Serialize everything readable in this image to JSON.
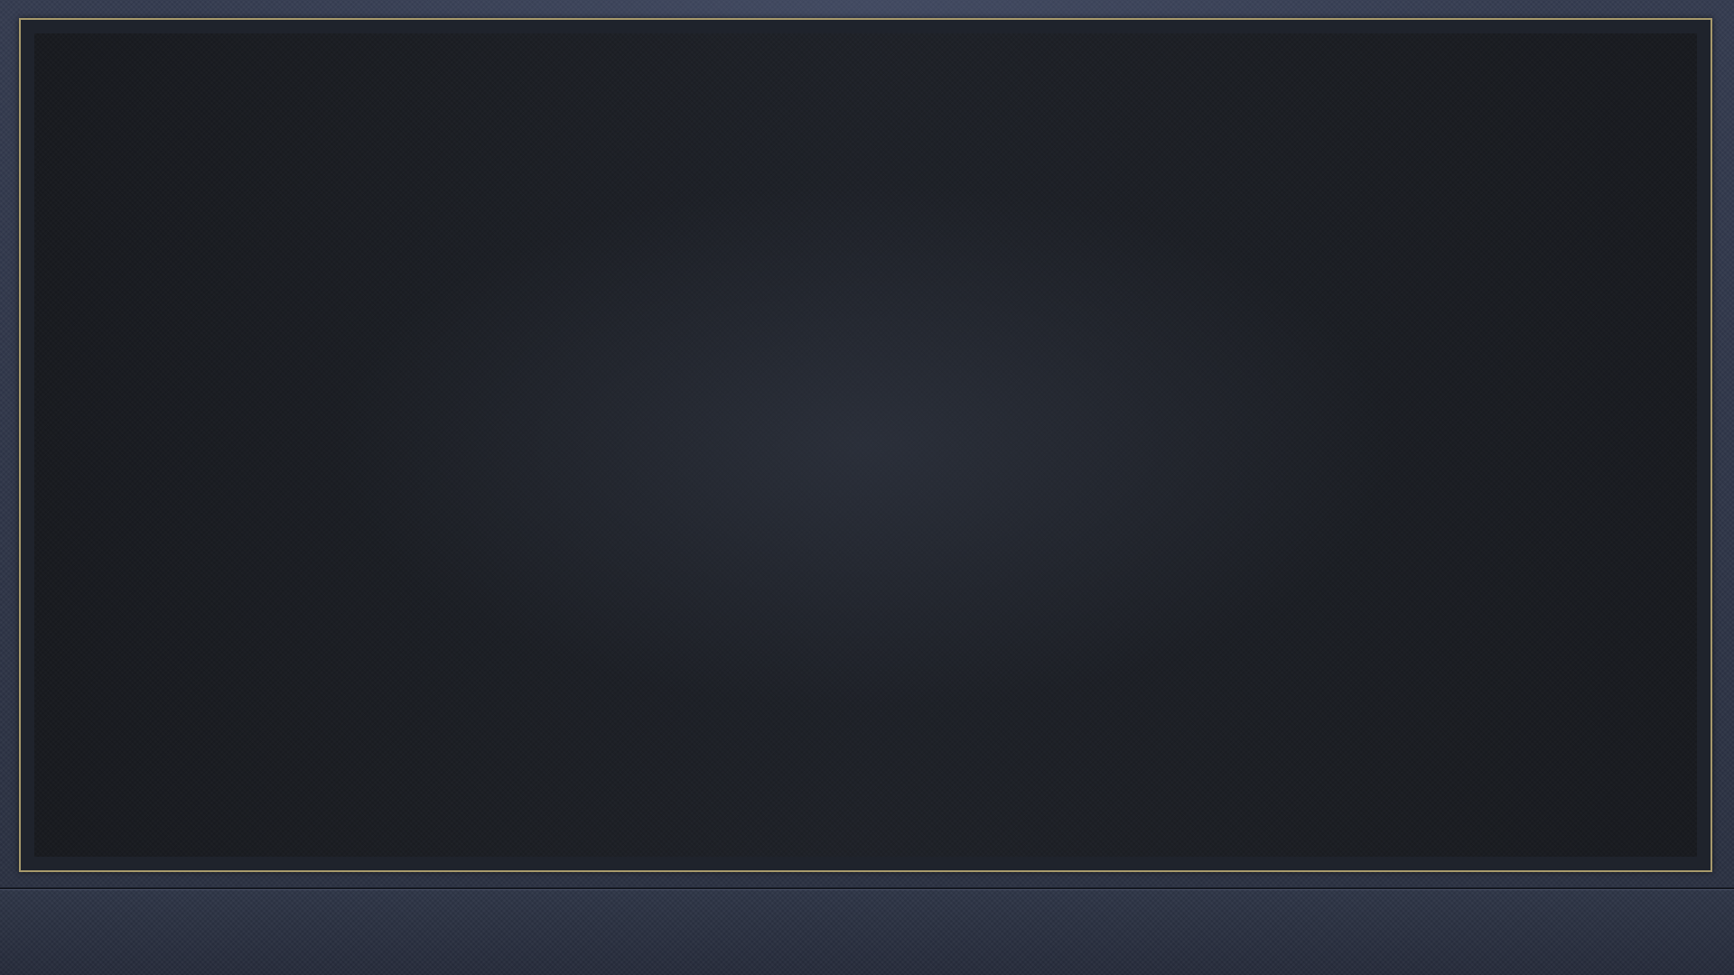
{
  "theme": {
    "frame_border_color": "#a89a6c",
    "background_color": "#2b3142",
    "panel_color": "#1b1e24"
  },
  "main_panel": {
    "content": ""
  },
  "bottom_bar": {
    "content": ""
  }
}
